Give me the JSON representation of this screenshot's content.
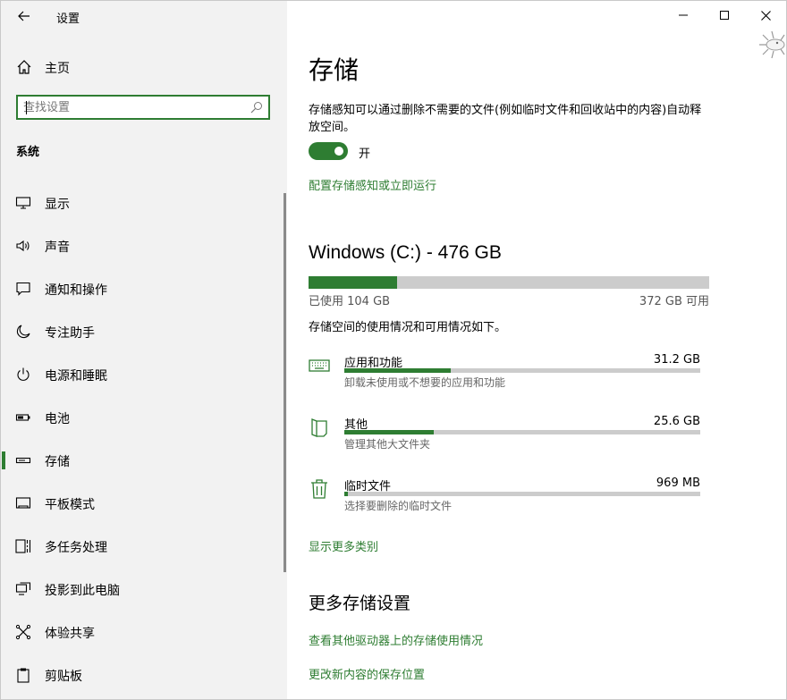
{
  "app": {
    "title": "设置"
  },
  "sidebar": {
    "home_label": "主页",
    "search_placeholder": "查找设置",
    "section_title": "系统",
    "items": [
      {
        "label": "显示",
        "icon": "monitor-icon"
      },
      {
        "label": "声音",
        "icon": "speaker-icon"
      },
      {
        "label": "通知和操作",
        "icon": "message-icon"
      },
      {
        "label": "专注助手",
        "icon": "moon-icon"
      },
      {
        "label": "电源和睡眠",
        "icon": "power-icon"
      },
      {
        "label": "电池",
        "icon": "battery-icon"
      },
      {
        "label": "存储",
        "icon": "storage-icon",
        "active": true
      },
      {
        "label": "平板模式",
        "icon": "tablet-icon"
      },
      {
        "label": "多任务处理",
        "icon": "multitask-icon"
      },
      {
        "label": "投影到此电脑",
        "icon": "project-icon"
      },
      {
        "label": "体验共享",
        "icon": "share-icon"
      },
      {
        "label": "剪贴板",
        "icon": "clipboard-icon"
      }
    ]
  },
  "main": {
    "title": "存储",
    "description": "存储感知可以通过删除不需要的文件(例如临时文件和回收站中的内容)自动释放空间。",
    "toggle_state": "开",
    "configure_link": "配置存储感知或立即运行",
    "drive": {
      "title": "Windows (C:) - 476 GB",
      "used_label": "已使用 104 GB",
      "free_label": "372 GB 可用",
      "used_fraction": 0.22
    },
    "usage_description": "存储空间的使用情况和可用情况如下。",
    "categories": [
      {
        "name": "应用和功能",
        "size": "31.2 GB",
        "sub": "卸载未使用或不想要的应用和功能",
        "fraction": 0.3,
        "icon": "keyboard-icon"
      },
      {
        "name": "其他",
        "size": "25.6 GB",
        "sub": "管理其他大文件夹",
        "fraction": 0.25,
        "icon": "file-icon"
      },
      {
        "name": "临时文件",
        "size": "969 MB",
        "sub": "选择要删除的临时文件",
        "fraction": 0.01,
        "icon": "trash-icon"
      }
    ],
    "show_more_link": "显示更多类别",
    "more_settings_title": "更多存储设置",
    "more_links": [
      "查看其他驱动器上的存储使用情况",
      "更改新内容的保存位置"
    ]
  },
  "colors": {
    "accent": "#2e7d32",
    "track": "#cccccc",
    "sidebar_bg": "#f2f2f2"
  }
}
